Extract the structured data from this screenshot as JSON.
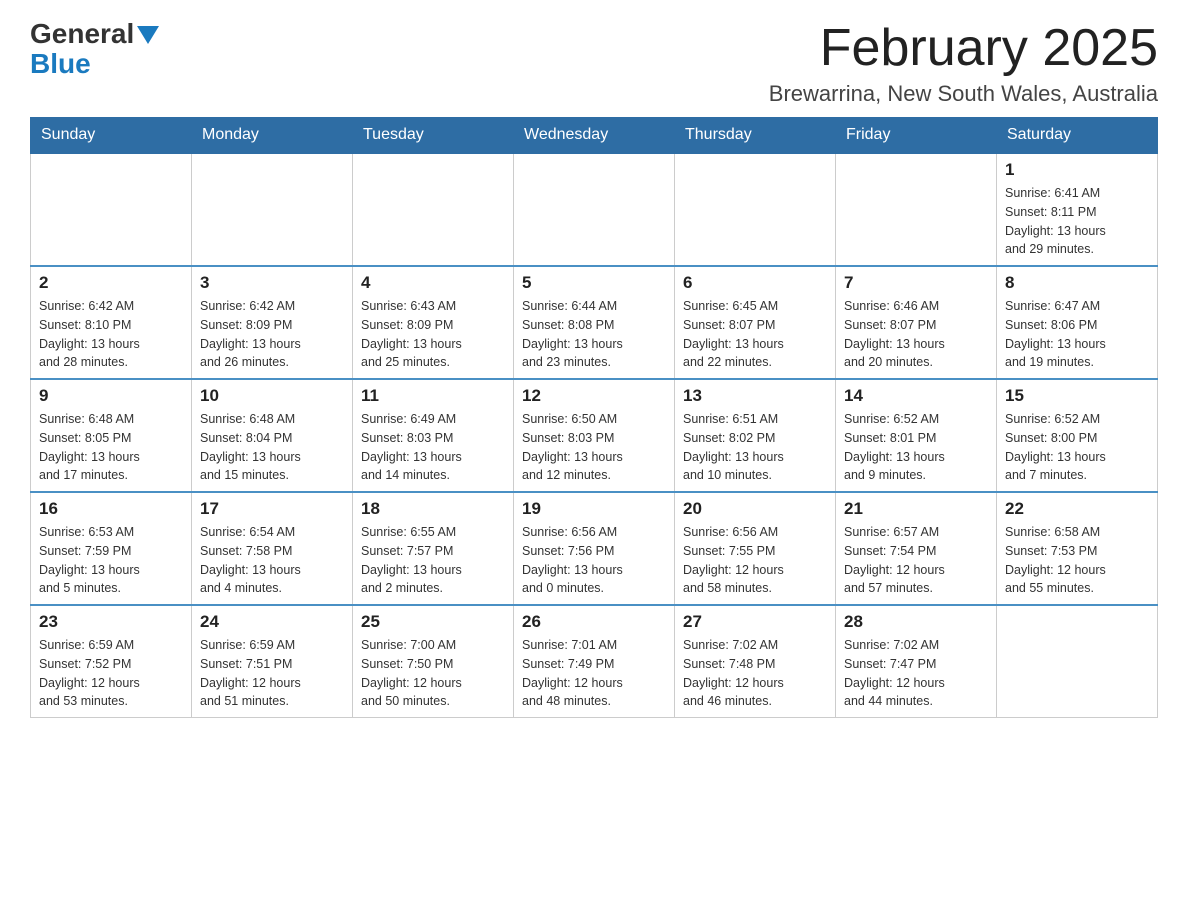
{
  "logo": {
    "text1": "General",
    "text2": "Blue"
  },
  "title": "February 2025",
  "location": "Brewarrina, New South Wales, Australia",
  "days_of_week": [
    "Sunday",
    "Monday",
    "Tuesday",
    "Wednesday",
    "Thursday",
    "Friday",
    "Saturday"
  ],
  "weeks": [
    [
      {
        "day": "",
        "info": ""
      },
      {
        "day": "",
        "info": ""
      },
      {
        "day": "",
        "info": ""
      },
      {
        "day": "",
        "info": ""
      },
      {
        "day": "",
        "info": ""
      },
      {
        "day": "",
        "info": ""
      },
      {
        "day": "1",
        "info": "Sunrise: 6:41 AM\nSunset: 8:11 PM\nDaylight: 13 hours\nand 29 minutes."
      }
    ],
    [
      {
        "day": "2",
        "info": "Sunrise: 6:42 AM\nSunset: 8:10 PM\nDaylight: 13 hours\nand 28 minutes."
      },
      {
        "day": "3",
        "info": "Sunrise: 6:42 AM\nSunset: 8:09 PM\nDaylight: 13 hours\nand 26 minutes."
      },
      {
        "day": "4",
        "info": "Sunrise: 6:43 AM\nSunset: 8:09 PM\nDaylight: 13 hours\nand 25 minutes."
      },
      {
        "day": "5",
        "info": "Sunrise: 6:44 AM\nSunset: 8:08 PM\nDaylight: 13 hours\nand 23 minutes."
      },
      {
        "day": "6",
        "info": "Sunrise: 6:45 AM\nSunset: 8:07 PM\nDaylight: 13 hours\nand 22 minutes."
      },
      {
        "day": "7",
        "info": "Sunrise: 6:46 AM\nSunset: 8:07 PM\nDaylight: 13 hours\nand 20 minutes."
      },
      {
        "day": "8",
        "info": "Sunrise: 6:47 AM\nSunset: 8:06 PM\nDaylight: 13 hours\nand 19 minutes."
      }
    ],
    [
      {
        "day": "9",
        "info": "Sunrise: 6:48 AM\nSunset: 8:05 PM\nDaylight: 13 hours\nand 17 minutes."
      },
      {
        "day": "10",
        "info": "Sunrise: 6:48 AM\nSunset: 8:04 PM\nDaylight: 13 hours\nand 15 minutes."
      },
      {
        "day": "11",
        "info": "Sunrise: 6:49 AM\nSunset: 8:03 PM\nDaylight: 13 hours\nand 14 minutes."
      },
      {
        "day": "12",
        "info": "Sunrise: 6:50 AM\nSunset: 8:03 PM\nDaylight: 13 hours\nand 12 minutes."
      },
      {
        "day": "13",
        "info": "Sunrise: 6:51 AM\nSunset: 8:02 PM\nDaylight: 13 hours\nand 10 minutes."
      },
      {
        "day": "14",
        "info": "Sunrise: 6:52 AM\nSunset: 8:01 PM\nDaylight: 13 hours\nand 9 minutes."
      },
      {
        "day": "15",
        "info": "Sunrise: 6:52 AM\nSunset: 8:00 PM\nDaylight: 13 hours\nand 7 minutes."
      }
    ],
    [
      {
        "day": "16",
        "info": "Sunrise: 6:53 AM\nSunset: 7:59 PM\nDaylight: 13 hours\nand 5 minutes."
      },
      {
        "day": "17",
        "info": "Sunrise: 6:54 AM\nSunset: 7:58 PM\nDaylight: 13 hours\nand 4 minutes."
      },
      {
        "day": "18",
        "info": "Sunrise: 6:55 AM\nSunset: 7:57 PM\nDaylight: 13 hours\nand 2 minutes."
      },
      {
        "day": "19",
        "info": "Sunrise: 6:56 AM\nSunset: 7:56 PM\nDaylight: 13 hours\nand 0 minutes."
      },
      {
        "day": "20",
        "info": "Sunrise: 6:56 AM\nSunset: 7:55 PM\nDaylight: 12 hours\nand 58 minutes."
      },
      {
        "day": "21",
        "info": "Sunrise: 6:57 AM\nSunset: 7:54 PM\nDaylight: 12 hours\nand 57 minutes."
      },
      {
        "day": "22",
        "info": "Sunrise: 6:58 AM\nSunset: 7:53 PM\nDaylight: 12 hours\nand 55 minutes."
      }
    ],
    [
      {
        "day": "23",
        "info": "Sunrise: 6:59 AM\nSunset: 7:52 PM\nDaylight: 12 hours\nand 53 minutes."
      },
      {
        "day": "24",
        "info": "Sunrise: 6:59 AM\nSunset: 7:51 PM\nDaylight: 12 hours\nand 51 minutes."
      },
      {
        "day": "25",
        "info": "Sunrise: 7:00 AM\nSunset: 7:50 PM\nDaylight: 12 hours\nand 50 minutes."
      },
      {
        "day": "26",
        "info": "Sunrise: 7:01 AM\nSunset: 7:49 PM\nDaylight: 12 hours\nand 48 minutes."
      },
      {
        "day": "27",
        "info": "Sunrise: 7:02 AM\nSunset: 7:48 PM\nDaylight: 12 hours\nand 46 minutes."
      },
      {
        "day": "28",
        "info": "Sunrise: 7:02 AM\nSunset: 7:47 PM\nDaylight: 12 hours\nand 44 minutes."
      },
      {
        "day": "",
        "info": ""
      }
    ]
  ]
}
